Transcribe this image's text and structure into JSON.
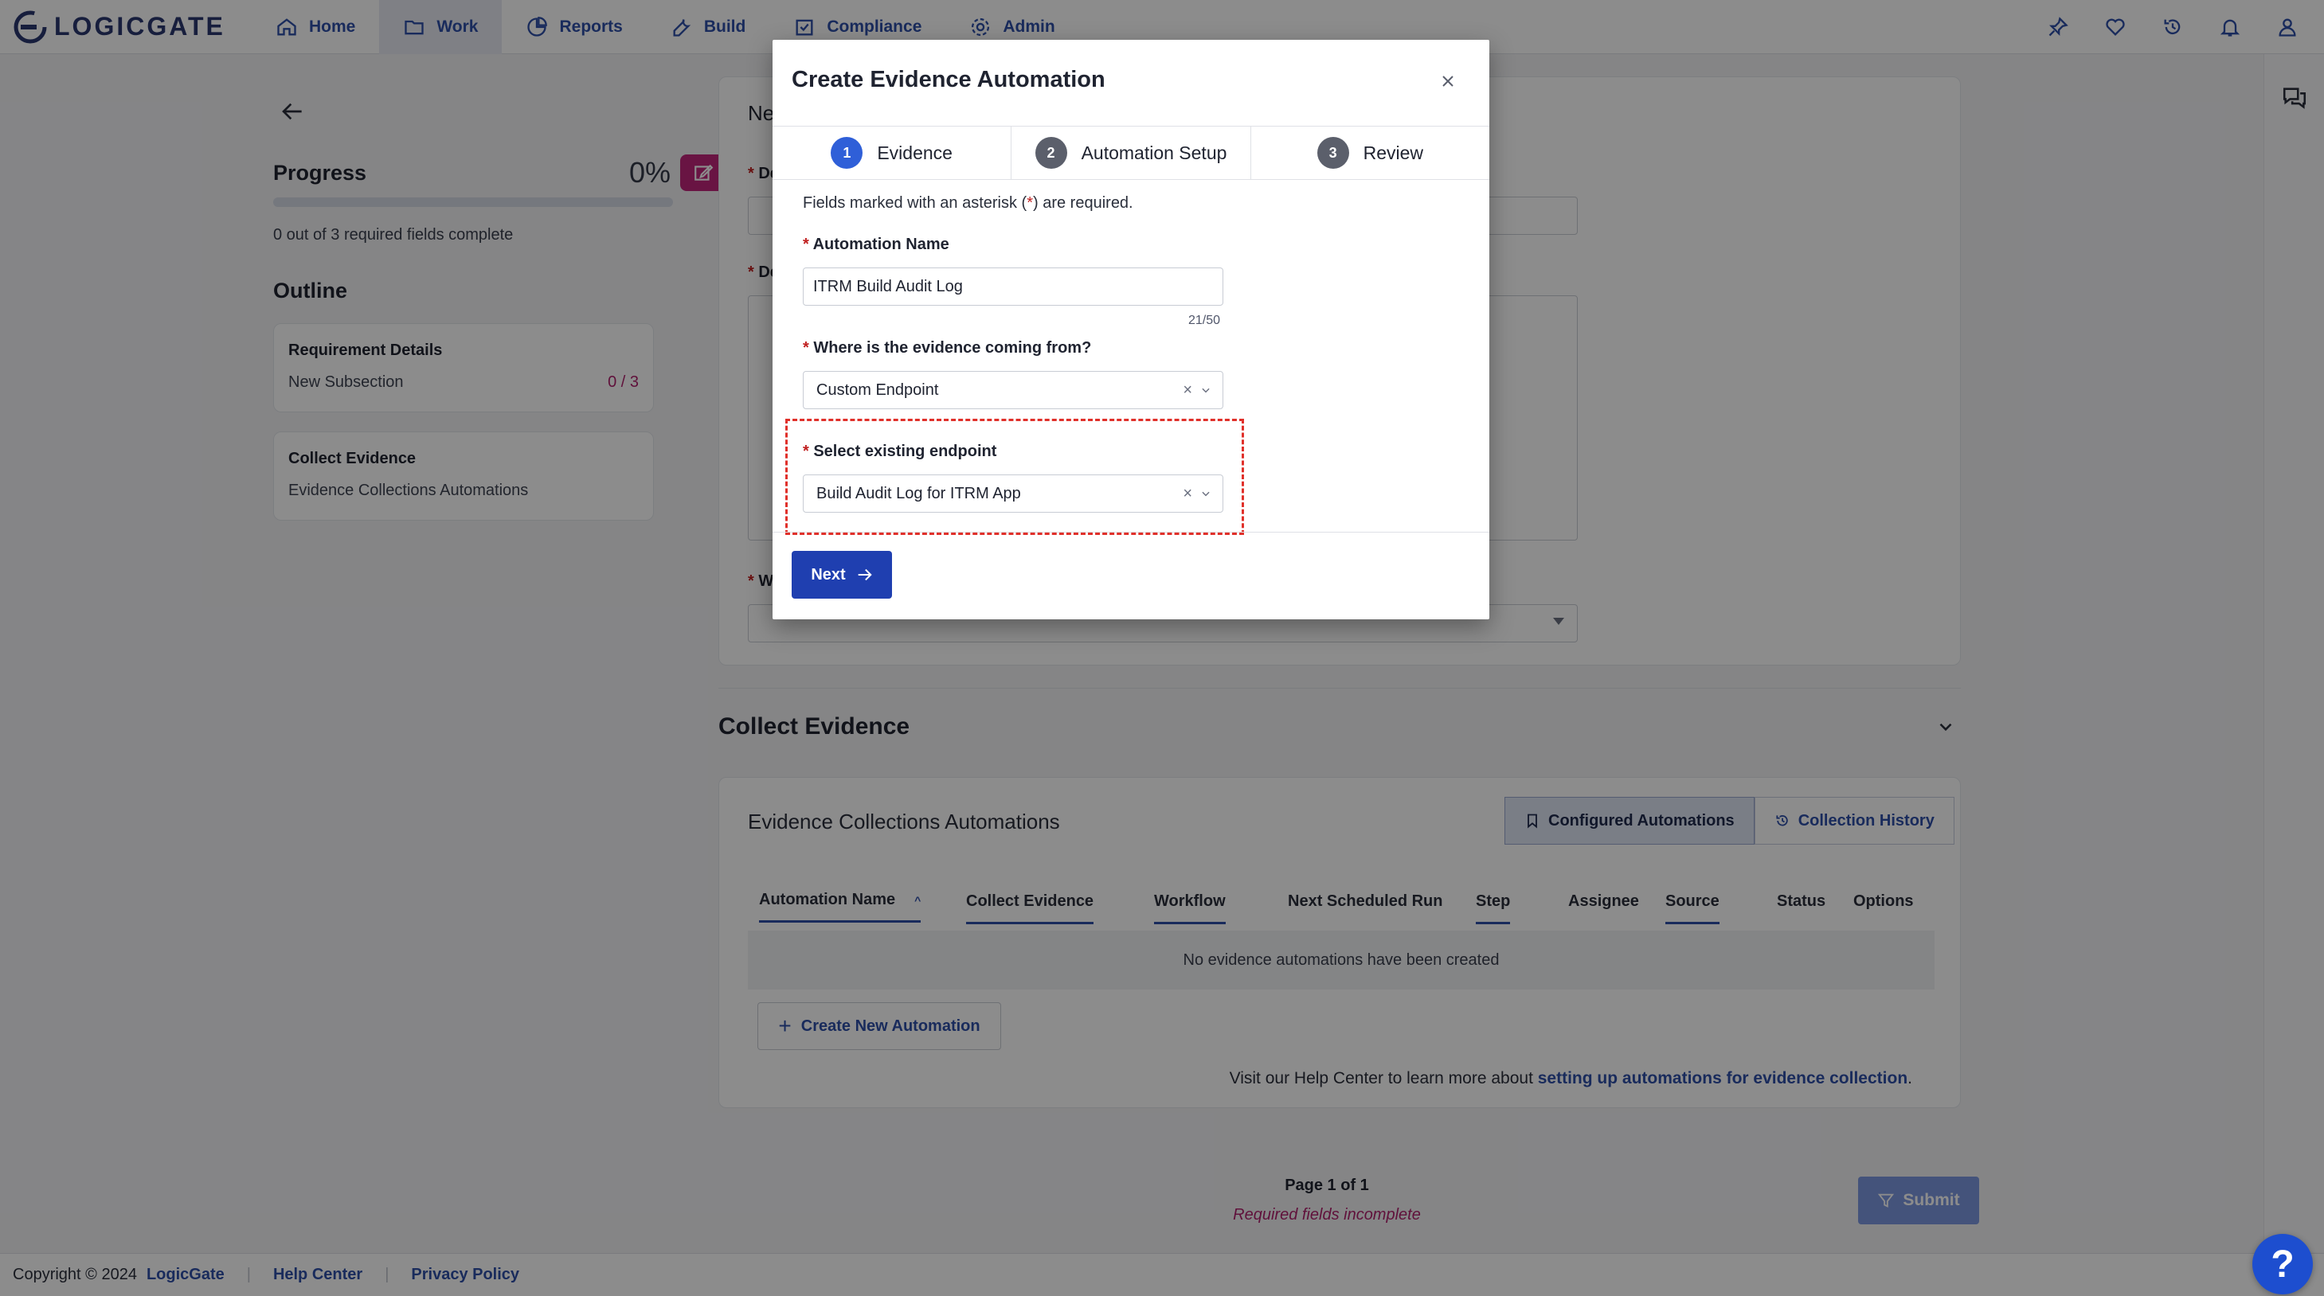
{
  "brand": {
    "name": "LOGICGATE"
  },
  "nav": {
    "items": [
      {
        "label": "Home",
        "icon": "home-icon"
      },
      {
        "label": "Work",
        "icon": "folder-icon",
        "active": true
      },
      {
        "label": "Reports",
        "icon": "chart-pie-icon"
      },
      {
        "label": "Build",
        "icon": "wrench-icon"
      },
      {
        "label": "Compliance",
        "icon": "checklist-icon"
      },
      {
        "label": "Admin",
        "icon": "gear-icon"
      }
    ],
    "right_icons": [
      "pin-icon",
      "heart-icon",
      "history-icon",
      "bell-icon",
      "user-icon"
    ]
  },
  "rail": {
    "icons": [
      "chat-icon"
    ]
  },
  "sidebar": {
    "progress_title": "Progress",
    "progress_percent": "0%",
    "progress_fraction": 0,
    "progress_count": "0 out of 3 required fields complete",
    "outline_title": "Outline",
    "cards": [
      {
        "title": "Requirement Details",
        "subtitle": "New Subsection",
        "count": "0 / 3"
      },
      {
        "title": "Collect Evidence",
        "subtitle": "Evidence Collections Automations",
        "count": ""
      }
    ]
  },
  "form": {
    "title_partial": "Ne",
    "label_1_partial": "De",
    "label_2_partial": "De",
    "label_3_partial": "Wl"
  },
  "collect_section": {
    "title": "Collect Evidence",
    "card_title": "Evidence Collections Automations",
    "tabs": [
      "Configured Automations",
      "Collection History"
    ],
    "columns": [
      "Automation Name",
      "Collect Evidence",
      "Workflow",
      "Next Scheduled Run",
      "Step",
      "Assignee",
      "Source",
      "Status",
      "Options"
    ],
    "empty_message": "No evidence automations have been created",
    "create_button": "Create New Automation",
    "help_prefix": "Visit our Help Center to learn more about ",
    "help_link": "setting up automations for evidence collection",
    "help_suffix": "."
  },
  "pager": {
    "page": "Page 1 of 1",
    "status": "Required fields incomplete"
  },
  "submit_label": "Submit",
  "footer": {
    "copyright": "Copyright © 2024",
    "links": [
      "LogicGate",
      "Help Center",
      "Privacy Policy"
    ]
  },
  "modal": {
    "title": "Create Evidence Automation",
    "close": "×",
    "steps": [
      {
        "num": "1",
        "label": "Evidence",
        "active": true
      },
      {
        "num": "2",
        "label": "Automation Setup"
      },
      {
        "num": "3",
        "label": "Review"
      }
    ],
    "required_note_pre": "Fields marked with an asterisk (",
    "required_note_ast": "*",
    "required_note_post": ") are required.",
    "automation_name_label": "Automation Name",
    "automation_name_value": "ITRM Build Audit Log",
    "automation_name_counter": "21/50",
    "source_label": "Where is the evidence coming from?",
    "source_value": "Custom Endpoint",
    "endpoint_label": "Select existing endpoint",
    "endpoint_value": "Build Audit Log for ITRM App",
    "clear_glyph": "×",
    "next_label": "Next"
  },
  "help_fab": "?",
  "colors": {
    "accent": "#2f4fa8",
    "brand_magenta": "#c0267a",
    "highlight": "#e0302a"
  }
}
